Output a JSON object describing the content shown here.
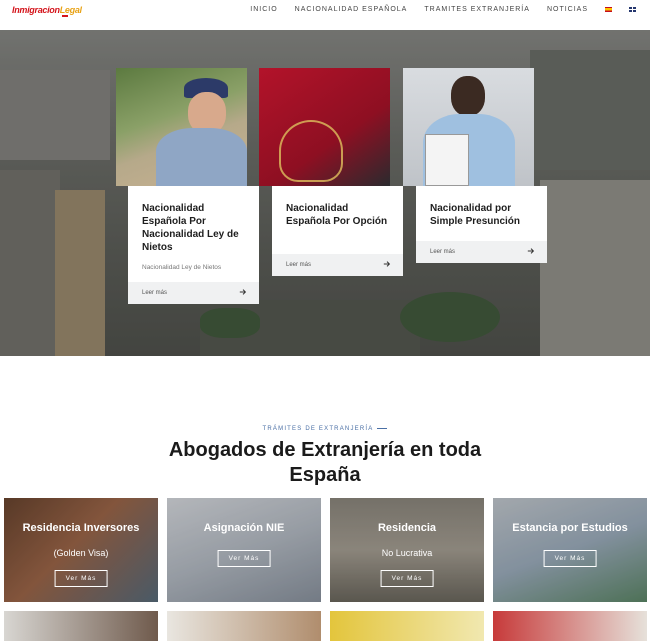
{
  "header": {
    "logo_part1": "Inmigracion",
    "logo_part2": "Legal",
    "nav": [
      "INICIO",
      "NACIONALIDAD ESPAÑOLA",
      "TRAMITES EXTRANJERÍA",
      "NOTICIAS"
    ],
    "flags": [
      "spain-flag-icon",
      "uk-flag-icon"
    ]
  },
  "hero_cards": [
    {
      "title": "Nacionalidad Española Por Nacionalidad Ley de Nietos",
      "subtitle": "Nacionalidad Ley de Nietos",
      "link": "Leer más"
    },
    {
      "title": "Nacionalidad Española Por Opción",
      "link": "Leer más"
    },
    {
      "title": "Nacionalidad por Simple Presunción",
      "link": "Leer más"
    }
  ],
  "section": {
    "kicker": "TRÁMITES DE EXTRANJERÍA",
    "title_line1": "Abogados de Extranjería en toda",
    "title_line2": "España"
  },
  "tiles": [
    {
      "title": "Residencia Inversores",
      "subtitle": "(Golden Visa)",
      "button": "Ver Más"
    },
    {
      "title": "Asignación NIE",
      "button": "Ver Más"
    },
    {
      "title": "Residencia",
      "subtitle": "No Lucrativa",
      "button": "Ver Más"
    },
    {
      "title": "Estancia por Estudios",
      "button": "Ver Más"
    }
  ],
  "colors": {
    "accent": "#4a6fa5",
    "logo_red": "#d4141b",
    "logo_gold": "#e8a317"
  }
}
